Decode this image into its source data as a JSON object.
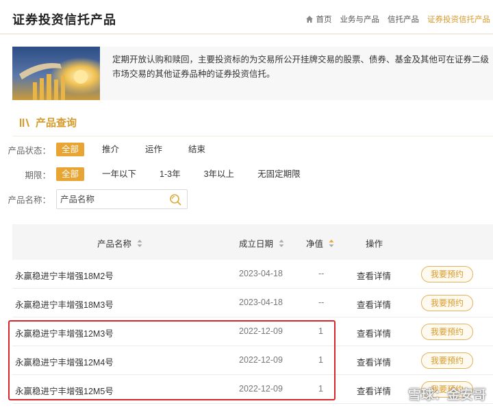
{
  "header": {
    "title": "证券投资信托产品",
    "breadcrumb": [
      "首页",
      "业务与产品",
      "信托产品",
      "证券投资信托产品"
    ]
  },
  "intro": {
    "text": "定期开放认购和赎回，主要投资标的为交易所公开挂牌交易的股票、债券、基金及其他可在证券二级市场交易的其他证券品种的证券投资信托。"
  },
  "query": {
    "title": "产品查询",
    "status": {
      "label": "产品状态：",
      "options": [
        "全部",
        "推介",
        "运作",
        "结束"
      ],
      "selected": "全部"
    },
    "period": {
      "label": "期限：",
      "options": [
        "全部",
        "一年以下",
        "1-3年",
        "3年以上",
        "无固定期限"
      ],
      "selected": "全部"
    },
    "name": {
      "label": "产品名称：",
      "placeholder": "产品名称"
    }
  },
  "table": {
    "headers": {
      "name": "产品名称",
      "date": "成立日期",
      "nav": "净值",
      "action": "操作"
    },
    "rows": [
      {
        "name": "永赢稳进宁丰增强18M2号",
        "date": "2023-04-18",
        "nav": "--",
        "detail": "查看详情",
        "reserve": "我要预约"
      },
      {
        "name": "永赢稳进宁丰增强18M3号",
        "date": "2023-04-18",
        "nav": "--",
        "detail": "查看详情",
        "reserve": "我要预约"
      },
      {
        "name": "永赢稳进宁丰增强12M3号",
        "date": "2022-12-09",
        "nav": "1",
        "detail": "查看详情",
        "reserve": "我要预约"
      },
      {
        "name": "永赢稳进宁丰增强12M4号",
        "date": "2022-12-09",
        "nav": "1",
        "detail": "查看详情",
        "reserve": "我要预约"
      },
      {
        "name": "永赢稳进宁丰增强12M5号",
        "date": "2022-12-09",
        "nav": "1",
        "detail": "查看详情",
        "reserve": "我要预约"
      }
    ]
  },
  "watermark": {
    "text": "雪球：金安哥"
  },
  "colors": {
    "accent": "#e8a534",
    "accent_text": "#d89a2b",
    "highlight": "#d9252a"
  },
  "icons": {
    "home": "home-icon",
    "search": "search-icon",
    "sort": "sort-icon",
    "section": "bars-icon"
  }
}
